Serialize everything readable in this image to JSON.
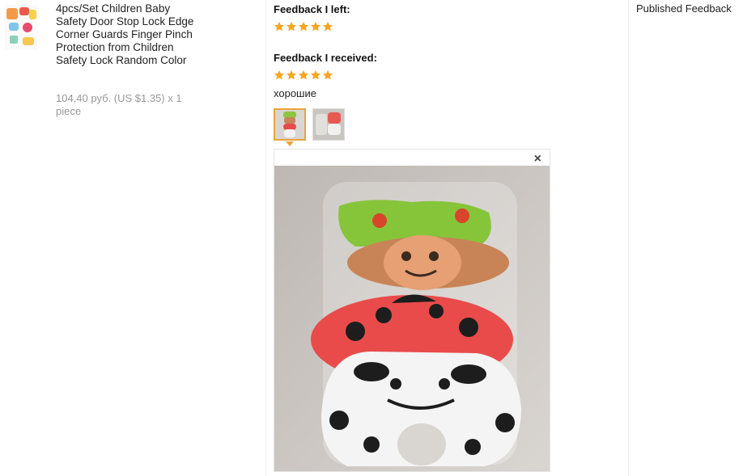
{
  "product": {
    "title": "4pcs/Set Children Baby Safety Door Stop Lock Edge Corner Guards Finger Pinch Protection from Children Safety Lock Random Color",
    "price_line": "104,40 руб. (US $1.35) x 1 piece",
    "thumbnail_icon": "product-thumbnail"
  },
  "feedback": {
    "left_label": "Feedback I left:",
    "left_rating": 5,
    "received_label": "Feedback I received:",
    "received_rating": 5,
    "comment": "хорошие",
    "photos": [
      "photo-1",
      "photo-2"
    ],
    "selected_photo": 0,
    "close_symbol": "×"
  },
  "status": {
    "label": "Published Feedback"
  },
  "colors": {
    "star": "#f5a623",
    "accent_border": "#e8a33d",
    "muted_text": "#999999",
    "divider": "#ececec"
  }
}
